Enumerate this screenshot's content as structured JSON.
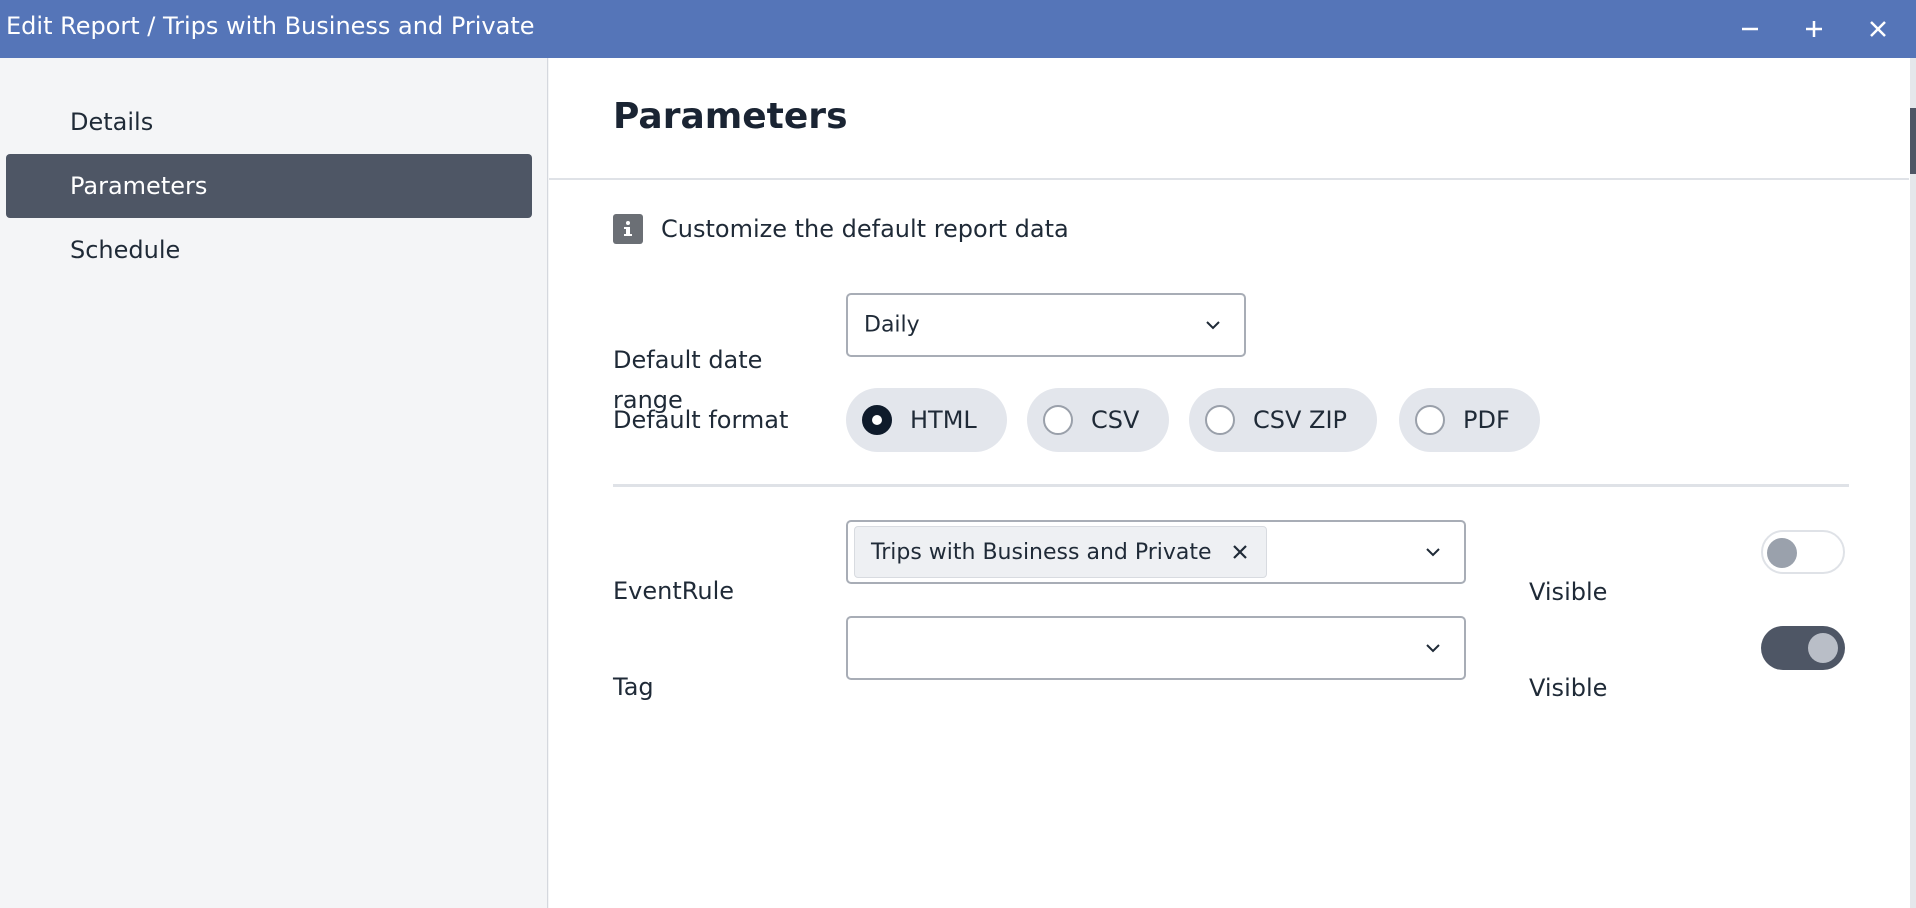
{
  "window": {
    "title": "Edit Report / Trips with Business and Private",
    "minimize_icon": "minus-icon",
    "maximize_icon": "plus-icon",
    "close_icon": "close-icon"
  },
  "sidebar": {
    "items": [
      {
        "label": "Details",
        "active": false
      },
      {
        "label": "Parameters",
        "active": true
      },
      {
        "label": "Schedule",
        "active": false
      }
    ]
  },
  "main": {
    "title": "Parameters",
    "info_text": "Customize the default report data",
    "info_icon": "info-icon",
    "date_range": {
      "label": "Default date range",
      "value": "Daily"
    },
    "format": {
      "label": "Default format",
      "options": [
        "HTML",
        "CSV",
        "CSV ZIP",
        "PDF"
      ],
      "selected": "HTML"
    },
    "event_rule": {
      "label": "EventRule",
      "chip": "Trips with Business and Private",
      "visible_label": "Visible",
      "visible": false
    },
    "tag": {
      "label": "Tag",
      "value": "",
      "visible_label": "Visible",
      "visible": true
    }
  },
  "colors": {
    "titlebar": "#5575b8",
    "active_nav": "#4e5665",
    "radio_checked": "#0f1b2b"
  }
}
